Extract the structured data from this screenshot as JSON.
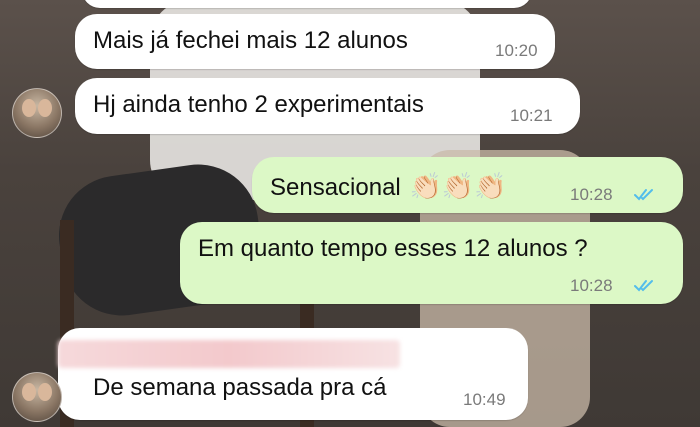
{
  "messages": [
    {
      "id": "m1",
      "text": "Mais já fechei mais 12 alunos",
      "time": "10:20",
      "direction": "incoming"
    },
    {
      "id": "m2",
      "text": "Hj ainda tenho 2 experimentais",
      "time": "10:21",
      "direction": "incoming"
    },
    {
      "id": "m3",
      "text": "Sensacional",
      "emoji": "👏🏻👏🏻👏🏻",
      "time": "10:28",
      "direction": "outgoing",
      "status": "read"
    },
    {
      "id": "m4",
      "text": "Em quanto tempo esses 12 alunos ?",
      "time": "10:28",
      "direction": "outgoing",
      "status": "read"
    },
    {
      "id": "m5",
      "text": "De semana passada pra cá",
      "time": "10:49",
      "direction": "incoming"
    }
  ],
  "colors": {
    "incoming_bubble": "#ffffff",
    "outgoing_bubble": "#dcf8c6",
    "read_ticks": "#53bdeb",
    "timestamp": "#7a7a7a"
  },
  "icons": {
    "read_status": "double-check-icon",
    "avatar": "contact-avatar"
  }
}
